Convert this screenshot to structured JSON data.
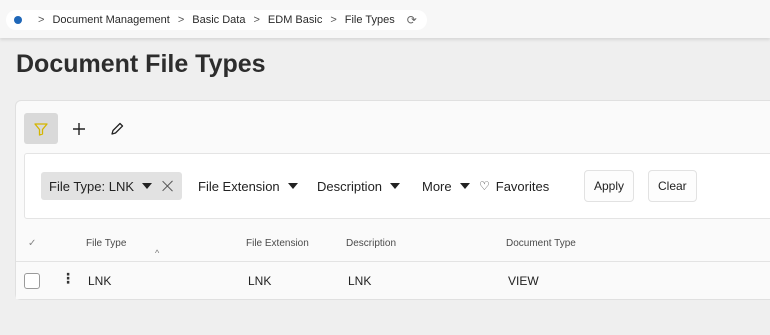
{
  "breadcrumb": {
    "items": [
      "Document Management",
      "Basic Data",
      "EDM Basic",
      "File Types"
    ]
  },
  "page": {
    "title": "Document File Types"
  },
  "toolbar": {
    "filter_icon": "filter-icon",
    "add_icon": "plus-icon",
    "edit_icon": "pencil-icon"
  },
  "filters": {
    "active_chip": "File Type: LNK",
    "dropdowns": [
      "File Extension",
      "Description",
      "More"
    ],
    "favorites": "Favorites",
    "apply": "Apply",
    "clear": "Clear"
  },
  "table": {
    "columns": [
      "File Type",
      "File Extension",
      "Description",
      "Document Type"
    ],
    "rows": [
      [
        "LNK",
        "LNK",
        "LNK",
        "VIEW"
      ]
    ]
  },
  "colors": {
    "accent": "#1f67b8",
    "filter_icon": "#d4b500"
  }
}
